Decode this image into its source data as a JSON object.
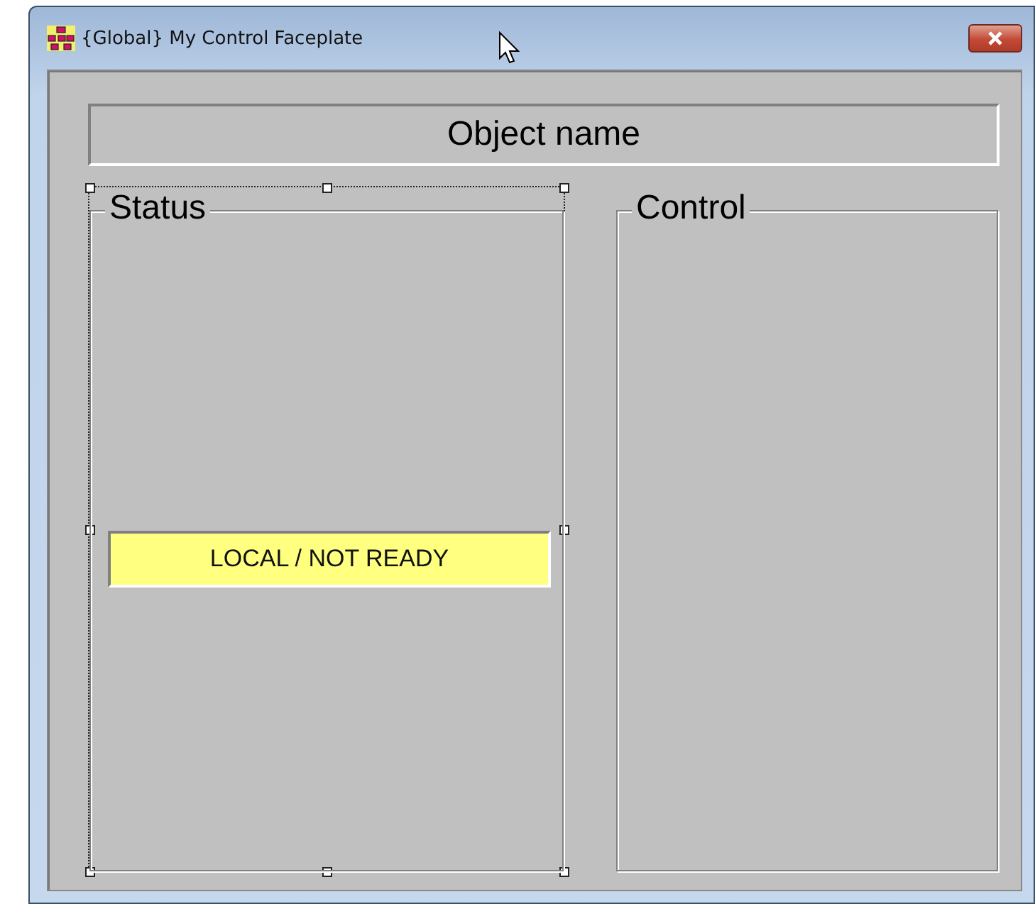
{
  "window": {
    "title": "{Global} My Control Faceplate"
  },
  "object_name": "Object name",
  "groups": [
    {
      "title": "Status",
      "selected": true,
      "indicator": "LOCAL / NOT READY"
    },
    {
      "title": "Control",
      "selected": false
    }
  ]
}
